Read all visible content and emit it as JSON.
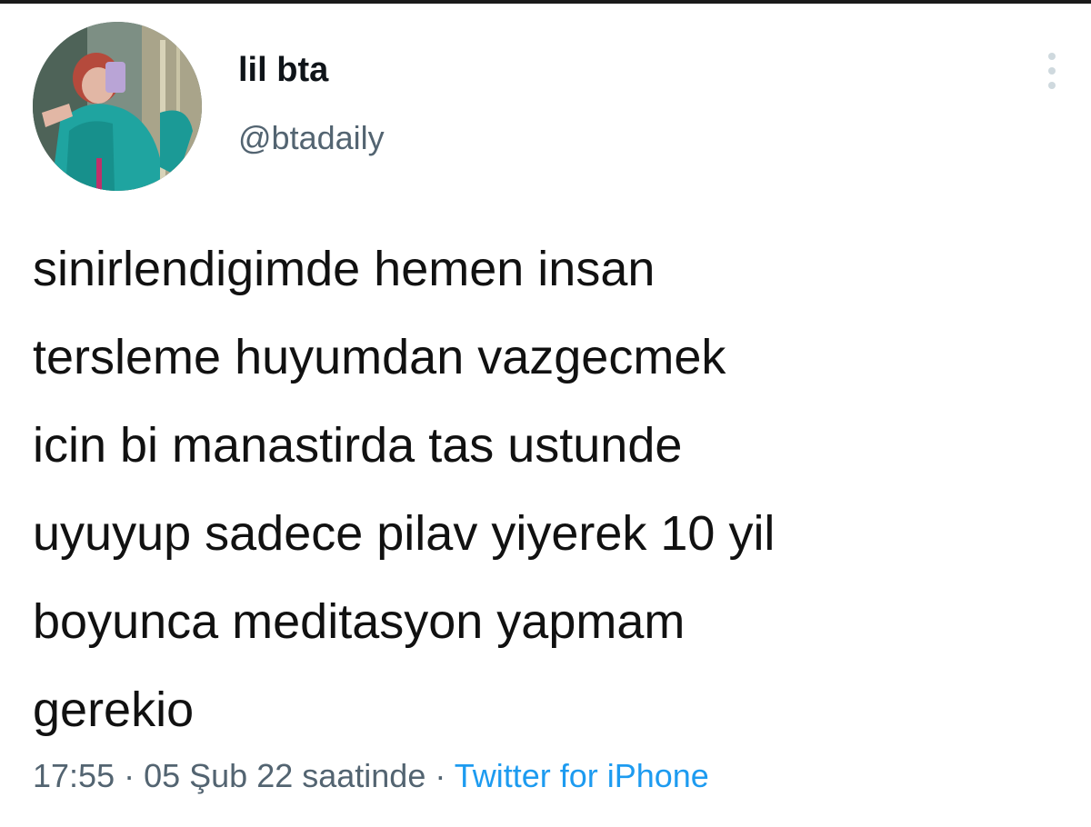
{
  "author": {
    "display_name": "lil bta",
    "handle": "@btadaily"
  },
  "tweet": {
    "text": "sinirlendigimde hemen insan\ntersleme huyumdan vazgecmek\nicin bi manastirda tas ustunde\nuyuyup sadece pilav yiyerek 10 yil\nboyunca meditasyon yapmam\ngerekio"
  },
  "meta": {
    "time": "17:55",
    "separator": " · ",
    "date": "05 Şub 22 saatinde",
    "separator2": " · ",
    "source": "Twitter for iPhone"
  },
  "colors": {
    "text": "#0f1419",
    "secondary": "#536471",
    "link": "#1d9bf0"
  },
  "icons": {
    "more": "more-vertical-icon"
  }
}
